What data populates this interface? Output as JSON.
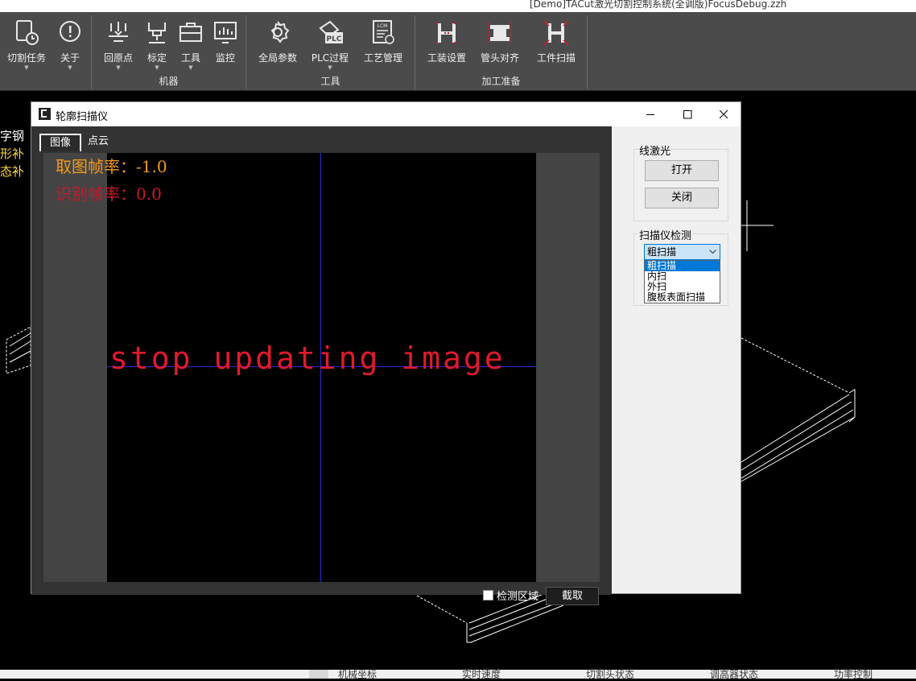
{
  "app": {
    "title": "[Demo]TACut激光切割控制系统(全调版)FocusDebug.zzh"
  },
  "ribbon": {
    "groups": [
      {
        "label": "",
        "buttons": [
          {
            "label": "切割任务",
            "icon": "cut-task-icon"
          },
          {
            "label": "关于",
            "icon": "about-icon"
          }
        ]
      },
      {
        "label": "机器",
        "buttons": [
          {
            "label": "回原点",
            "icon": "home-icon"
          },
          {
            "label": "标定",
            "icon": "calibrate-icon"
          },
          {
            "label": "工具",
            "icon": "toolbox-icon"
          },
          {
            "label": "监控",
            "icon": "monitor-icon"
          }
        ]
      },
      {
        "label": "工具",
        "buttons": [
          {
            "label": "全局参数",
            "icon": "gear-icon"
          },
          {
            "label": "PLC过程",
            "icon": "plc-icon"
          },
          {
            "label": "工艺管理",
            "icon": "lcm-icon"
          }
        ]
      },
      {
        "label": "加工准备",
        "buttons": [
          {
            "label": "工装设置",
            "icon": "fixture-icon"
          },
          {
            "label": "管头对齐",
            "icon": "tube-align-icon"
          },
          {
            "label": "工件扫描",
            "icon": "workpiece-scan-icon"
          }
        ]
      }
    ]
  },
  "canvas": {
    "side_text": [
      "字钢",
      "形补",
      "态补"
    ]
  },
  "statusbar": {
    "cells": [
      "机械坐标",
      "实时速度",
      "切割头状态",
      "调高器状态",
      "功率控制"
    ]
  },
  "dialog": {
    "title": "轮廓扫描仪",
    "tabs": [
      {
        "label": "图像",
        "active": true
      },
      {
        "label": "点云",
        "active": false
      }
    ],
    "image": {
      "frame_rate": "取图帧率：-1.0",
      "recognize_rate": "识别帧率：0.0",
      "status_message": "stop updating image"
    },
    "detect_region_label": "检测区域",
    "detect_region_checked": false,
    "capture_label": "截取",
    "laser_group": {
      "title": "线激光",
      "open_label": "打开",
      "close_label": "关闭"
    },
    "scanner_group": {
      "title": "扫描仪检测",
      "selected": "粗扫描",
      "options": [
        "粗扫描",
        "内扫",
        "外扫",
        "腹板表面扫描"
      ]
    }
  },
  "colors": {
    "ribbon_bg": "#4b4b4b",
    "accent_red": "#e01a2a",
    "fps_orange": "#f39b1a",
    "select_blue": "#0078d7",
    "crosshair_blue": "#2a2ad8"
  }
}
